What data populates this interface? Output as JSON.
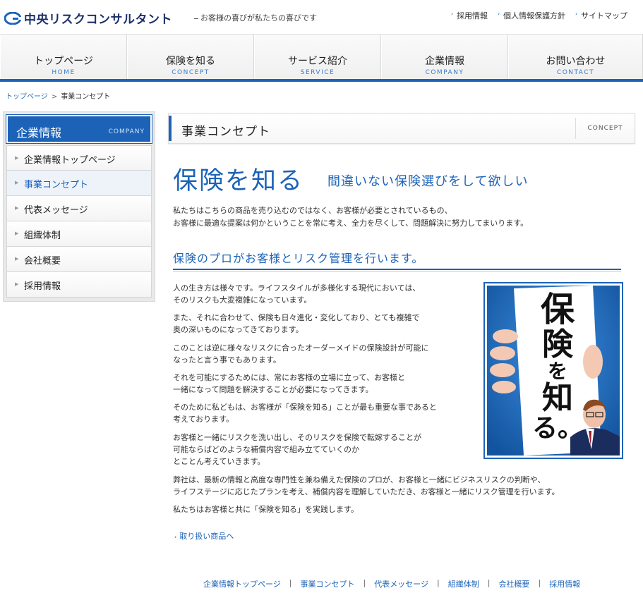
{
  "header": {
    "logo_text": "中央リスクコンサルタント",
    "tagline": "お客様の喜びが私たちの喜びです",
    "util_links": [
      "採用情報",
      "個人情報保護方針",
      "サイトマップ"
    ]
  },
  "gnav": [
    {
      "ja": "トップページ",
      "en": "HOME"
    },
    {
      "ja": "保険を知る",
      "en": "CONCEPT"
    },
    {
      "ja": "サービス紹介",
      "en": "SERVICE"
    },
    {
      "ja": "企業情報",
      "en": "COMPANY"
    },
    {
      "ja": "お問い合わせ",
      "en": "CONTACT"
    }
  ],
  "breadcrumb": {
    "home": "トップページ",
    "separator": ">",
    "current": "事業コンセプト"
  },
  "sidebar": {
    "title": "企業情報",
    "title_en": "COMPANY",
    "items": [
      {
        "label": "企業情報トップページ"
      },
      {
        "label": "事業コンセプト"
      },
      {
        "label": "代表メッセージ"
      },
      {
        "label": "組織体制"
      },
      {
        "label": "会社概要"
      },
      {
        "label": "採用情報"
      }
    ]
  },
  "main": {
    "title": "事業コンセプト",
    "title_en": "CONCEPT",
    "big_title": "保険を知る",
    "big_sub": "間違いない保険選びをして欲しい",
    "intro": [
      "私たちはこちらの商品を売り込むのではなく、お客様が必要とされているもの、",
      "お客様に最適な提案は何かということを常に考え、全力を尽くして、問題解決に努力してまいります。"
    ],
    "h2": "保険のプロがお客様とリスク管理を行います。",
    "paragraphs": [
      [
        "人の生き方は様々です。ライフスタイルが多様化する現代においては、",
        "そのリスクも大変複雑になっています。"
      ],
      [
        "また、それに合わせて、保険も日々進化・変化しており、とても複雑で",
        "奥の深いものになってきております。"
      ],
      [
        "このことは逆に様々なリスクに合ったオーダーメイドの保険設計が可能に",
        "なったと言う事でもあります。"
      ],
      [
        "それを可能にするためには、常にお客様の立場に立って、お客様と",
        "一緒になって問題を解決することが必要になってきます。"
      ],
      [
        "そのために私どもは、お客様が「保険を知る」ことが最も重要な事であると",
        "考えております。"
      ],
      [
        "お客様と一緒にリスクを洗い出し、そのリスクを保険で転嫁することが",
        "可能ならばどのような補償内容で組み立てていくのか",
        "とことん考えていきます。"
      ],
      [
        "弊社は、最新の情報と高度な専門性を兼ね備えた保険のプロが、お客様と一緒にビジネスリスクの判断や、",
        "ライフステージに応じたプランを考え、補償内容を理解していただき、お客様と一緒にリスク管理を行います。"
      ],
      [
        "私たちはお客様と共に「保険を知る」を実践します。"
      ]
    ],
    "photo_text": [
      "保",
      "険",
      "を",
      "知",
      "る。"
    ],
    "more_link": "取り扱い商品へ"
  },
  "footer_links": [
    "企業情報トップページ",
    "事業コンセプト",
    "代表メッセージ",
    "組織体制",
    "会社概要",
    "採用情報"
  ],
  "colors": {
    "brand": "#1c63b8",
    "logo": "#1d2f6b"
  }
}
